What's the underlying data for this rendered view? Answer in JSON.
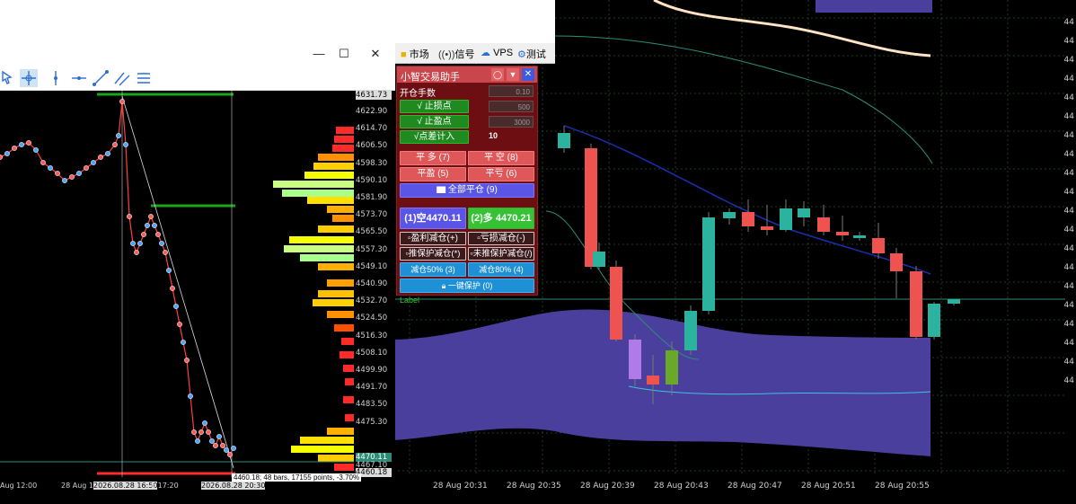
{
  "menu": {
    "items": [
      {
        "icon": "bag-icon",
        "label": "市场"
      },
      {
        "icon": "signal-icon",
        "label": "信号"
      },
      {
        "icon": "cloud-icon",
        "label": "VPS"
      },
      {
        "icon": "tester-icon",
        "label": "测试"
      }
    ]
  },
  "panel": {
    "title": "小智交易助手",
    "open_lots_label": "开仓手数",
    "open_lots_value": "0.10",
    "stop_loss_label": "√ 止损点",
    "stop_loss_value": "500",
    "take_profit_label": "√ 止盈点",
    "take_profit_value": "3000",
    "spread_label": "√点差计入",
    "spread_value": "10",
    "close_long": "平 多 (7)",
    "close_short": "平 空 (8)",
    "close_profit": "平盈 (5)",
    "close_loss": "平亏 (6)",
    "close_all": "全部平仓 (9)",
    "sell_price": "(1)空4470.11",
    "buy_price": "(2)多 4470.21",
    "reduce_profit": "盈利减仓(+)",
    "reduce_loss": "亏损减仓(-)",
    "trail_protect": "推保护减仓(*)",
    "no_trail_protect": "未推保护减仓(/)",
    "reduce50": "减仓50% (3)",
    "reduce80": "减仓80% (4)",
    "one_key_protect": "一键保护 (0)"
  },
  "right_chart": {
    "label_tag": "Label",
    "price_labels": [
      "44",
      "44",
      "44",
      "44",
      "44",
      "44",
      "44",
      "44",
      "44",
      "44",
      "44",
      "44",
      "44",
      "44",
      "44",
      "44",
      "44",
      "44",
      "44",
      "44"
    ],
    "time_labels": [
      "28 Aug 20:31",
      "28 Aug 20:35",
      "28 Aug 20:39",
      "28 Aug 20:43",
      "28 Aug 20:47",
      "28 Aug 20:51",
      "28 Aug 20:55"
    ],
    "colors": {
      "up": "#2bb3a0",
      "down": "#ef5350",
      "band": "#4b3f9e",
      "ma": "#ffe4c4"
    }
  },
  "left_chart": {
    "price_labels": [
      "4631.73",
      "4622.90",
      "4614.70",
      "4606.50",
      "4598.30",
      "4590.10",
      "4581.90",
      "4573.70",
      "4565.50",
      "4557.30",
      "4549.10",
      "4540.90",
      "4532.70",
      "4524.50",
      "4516.30",
      "4508.10",
      "4499.90",
      "4491.70",
      "4483.50",
      "4475.30",
      "4470.11",
      "4467.10",
      "4460.18"
    ],
    "time_labels": [
      "Aug 12:00",
      "28 Aug 1",
      "2026.08.28 16:50",
      "g 17:20",
      "2026.08.28 20:30"
    ],
    "measure_text": "4460.18; 48 bars, 17155 points, -3.70%"
  }
}
